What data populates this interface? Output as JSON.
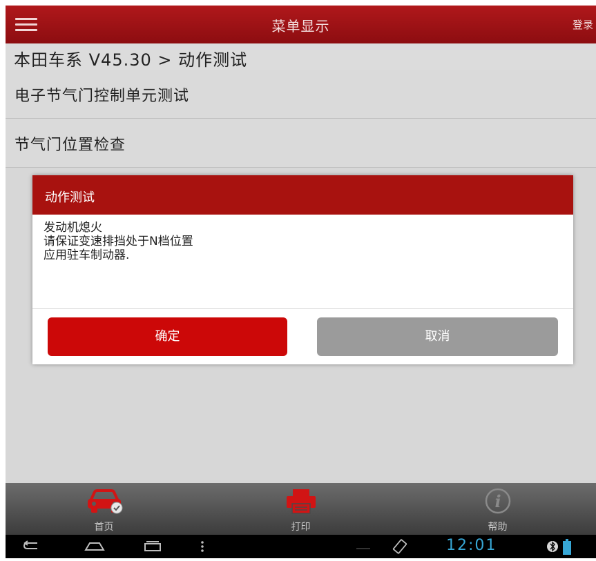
{
  "header": {
    "title": "菜单显示",
    "login_label": "登录"
  },
  "breadcrumb": "本田车系 V45.30 > 动作测试",
  "list": {
    "items": [
      {
        "label": "电子节气门控制单元测试"
      },
      {
        "label": "节气门位置检查"
      }
    ]
  },
  "dialog": {
    "title": "动作测试",
    "message_lines": [
      "发动机熄火",
      "请保证变速排挡处于N档位置",
      "应用驻车制动器."
    ],
    "ok_label": "确定",
    "cancel_label": "取消"
  },
  "tabs": [
    {
      "label": "首页",
      "icon": "car-check-icon"
    },
    {
      "label": "打印",
      "icon": "printer-icon"
    },
    {
      "label": "帮助",
      "icon": "info-icon"
    }
  ],
  "system_bar": {
    "time": "12:01"
  },
  "colors": {
    "header_red": "#a8120f",
    "ok_button": "#cc0808",
    "cancel_button": "#9b9b9b",
    "clock_blue": "#37a7d6"
  }
}
